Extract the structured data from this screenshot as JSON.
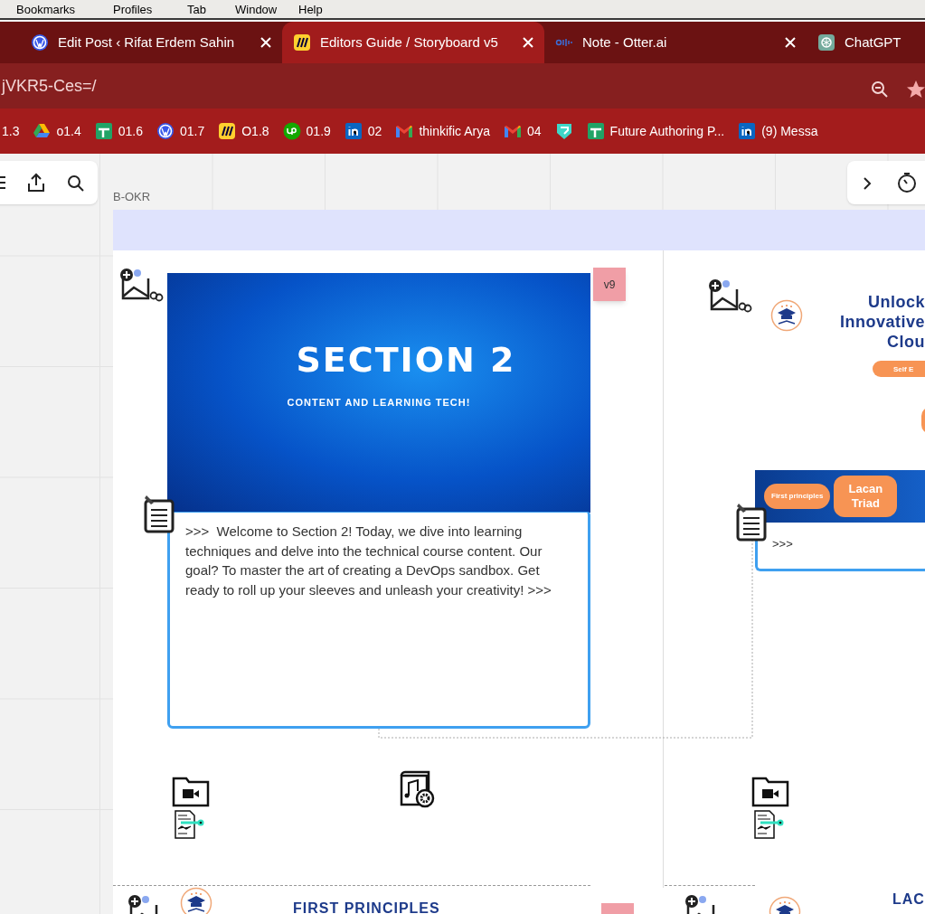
{
  "menu_bar": [
    "Bookmarks",
    "Profiles",
    "Tab",
    "Window",
    "Help"
  ],
  "tabs": [
    {
      "title": "Edit Post ‹ Rifat Erdem Sahin",
      "kind": "wordpress",
      "selected": false
    },
    {
      "title": "Editors Guide / Storyboard v5",
      "kind": "miro",
      "selected": true
    },
    {
      "title": "Note - Otter.ai",
      "kind": "otter",
      "selected": false
    },
    {
      "title": "ChatGPT",
      "kind": "chatgpt",
      "selected": false
    }
  ],
  "address": "jVKR5-Ces=/",
  "bookmarks": [
    {
      "label": "1.3",
      "kind": "none"
    },
    {
      "label": "o1.4",
      "kind": "drive"
    },
    {
      "label": "01.6",
      "kind": "sheets"
    },
    {
      "label": "01.7",
      "kind": "wordpress"
    },
    {
      "label": "O1.8",
      "kind": "miro"
    },
    {
      "label": "01.9",
      "kind": "upwork"
    },
    {
      "label": "02",
      "kind": "linkedin"
    },
    {
      "label": "thinkific Arya",
      "kind": "gmail"
    },
    {
      "label": "04",
      "kind": "gmail"
    },
    {
      "kind": "pen"
    },
    {
      "label": "Future Authoring P...",
      "kind": "sheets"
    },
    {
      "label": "(9) Messa",
      "kind": "linkedin"
    }
  ],
  "board": {
    "frame_label": "B-OKR",
    "slide": {
      "title": "SECTION 2",
      "subtitle": "CONTENT AND LEARNING TECH!"
    },
    "note": ">>>  Welcome to Section 2! Today, we dive into learning techniques and delve into the technical course content. Our goal? To master the art of creating a DevOps sandbox. Get ready to roll up your sleeves and unleash your creativity! >>>",
    "version_tag": "v9",
    "right_card": {
      "heading": "Unlock\nInnovative\nClou",
      "badge": "Self E",
      "chips": [
        "First principles",
        "Lacan Triad"
      ],
      "note": ">>>"
    },
    "bottom_heading": "FIRST PRINCIPLES",
    "bottom_right_heading": "LAC"
  }
}
